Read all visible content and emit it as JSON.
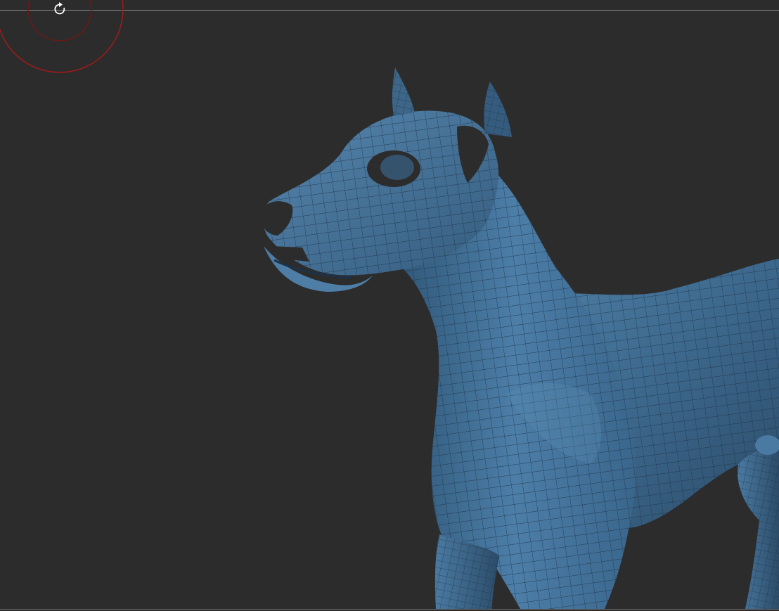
{
  "viewport": {
    "background_color": "#2c2c2c",
    "mesh_color": "#3d6688",
    "mesh_highlight_color": "#5a8bb3",
    "mesh_shadow_color": "#1c3248",
    "wire_color": "#1e3347",
    "gizmo_color": "#9b1c1c"
  },
  "gizmo": {
    "icon": "rotate-icon"
  },
  "model": {
    "subject": "dog-mesh"
  }
}
